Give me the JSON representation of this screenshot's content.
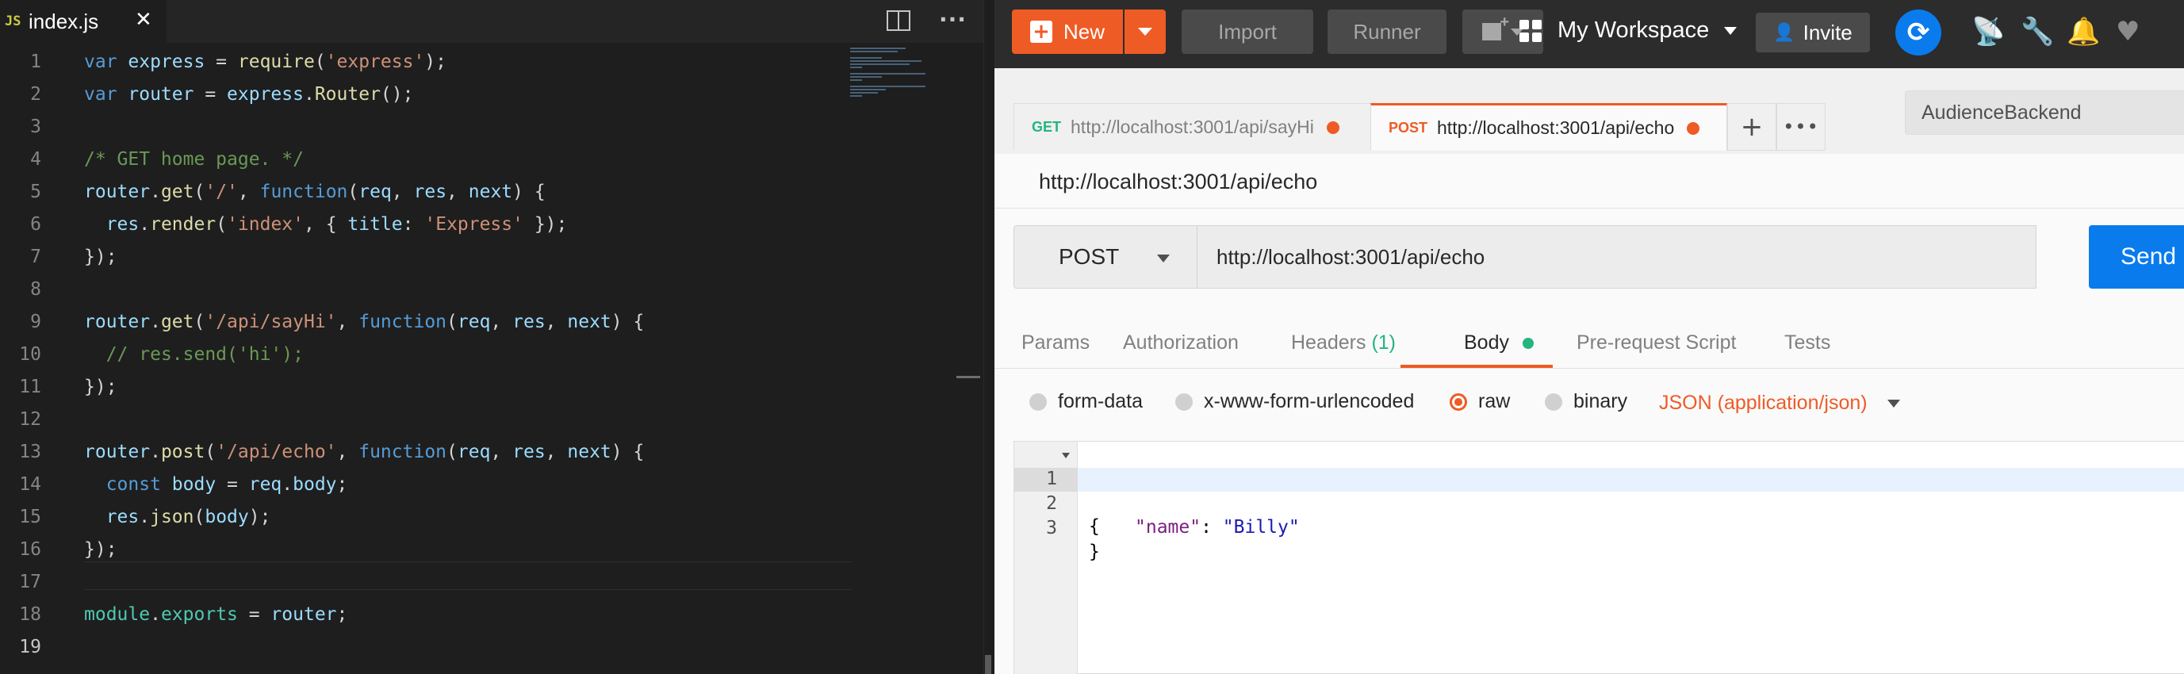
{
  "editor": {
    "tab": {
      "icon": "JS",
      "title": "index.js",
      "close": "✕"
    },
    "code_lines": [
      {
        "n": "1",
        "segments": [
          [
            "kw",
            "var "
          ],
          [
            "var",
            "express"
          ],
          [
            "pl",
            " = "
          ],
          [
            "fn",
            "require"
          ],
          [
            "pl",
            "("
          ],
          [
            "str",
            "'express'"
          ],
          [
            "pl",
            ");"
          ]
        ]
      },
      {
        "n": "2",
        "segments": [
          [
            "kw",
            "var "
          ],
          [
            "var",
            "router"
          ],
          [
            "pl",
            " = "
          ],
          [
            "var",
            "express"
          ],
          [
            "pl",
            "."
          ],
          [
            "fn",
            "Router"
          ],
          [
            "pl",
            "();"
          ]
        ]
      },
      {
        "n": "3",
        "segments": []
      },
      {
        "n": "4",
        "segments": [
          [
            "cm",
            "/* GET home page. */"
          ]
        ]
      },
      {
        "n": "5",
        "segments": [
          [
            "var",
            "router"
          ],
          [
            "pl",
            "."
          ],
          [
            "fn",
            "get"
          ],
          [
            "pl",
            "("
          ],
          [
            "str",
            "'/'"
          ],
          [
            "pl",
            ", "
          ],
          [
            "kw",
            "function"
          ],
          [
            "pl",
            "("
          ],
          [
            "var",
            "req"
          ],
          [
            "pl",
            ", "
          ],
          [
            "var",
            "res"
          ],
          [
            "pl",
            ", "
          ],
          [
            "var",
            "next"
          ],
          [
            "pl",
            ") {"
          ]
        ]
      },
      {
        "n": "6",
        "segments": [
          [
            "pl",
            "  "
          ],
          [
            "var",
            "res"
          ],
          [
            "pl",
            "."
          ],
          [
            "fn",
            "render"
          ],
          [
            "pl",
            "("
          ],
          [
            "str",
            "'index'"
          ],
          [
            "pl",
            ", { "
          ],
          [
            "var",
            "title"
          ],
          [
            "pl",
            ": "
          ],
          [
            "str",
            "'Express'"
          ],
          [
            "pl",
            " });"
          ]
        ]
      },
      {
        "n": "7",
        "segments": [
          [
            "pl",
            "});"
          ]
        ]
      },
      {
        "n": "8",
        "segments": []
      },
      {
        "n": "9",
        "segments": [
          [
            "var",
            "router"
          ],
          [
            "pl",
            "."
          ],
          [
            "fn",
            "get"
          ],
          [
            "pl",
            "("
          ],
          [
            "str",
            "'/api/sayHi'"
          ],
          [
            "pl",
            ", "
          ],
          [
            "kw",
            "function"
          ],
          [
            "pl",
            "("
          ],
          [
            "var",
            "req"
          ],
          [
            "pl",
            ", "
          ],
          [
            "var",
            "res"
          ],
          [
            "pl",
            ", "
          ],
          [
            "var",
            "next"
          ],
          [
            "pl",
            ") {"
          ]
        ]
      },
      {
        "n": "10",
        "segments": [
          [
            "pl",
            "  "
          ],
          [
            "cm",
            "// res.send('hi');"
          ]
        ]
      },
      {
        "n": "11",
        "segments": [
          [
            "pl",
            "});"
          ]
        ]
      },
      {
        "n": "12",
        "segments": []
      },
      {
        "n": "13",
        "segments": [
          [
            "var",
            "router"
          ],
          [
            "pl",
            "."
          ],
          [
            "fn",
            "post"
          ],
          [
            "pl",
            "("
          ],
          [
            "str",
            "'/api/echo'"
          ],
          [
            "pl",
            ", "
          ],
          [
            "kw",
            "function"
          ],
          [
            "pl",
            "("
          ],
          [
            "var",
            "req"
          ],
          [
            "pl",
            ", "
          ],
          [
            "var",
            "res"
          ],
          [
            "pl",
            ", "
          ],
          [
            "var",
            "next"
          ],
          [
            "pl",
            ") {"
          ]
        ]
      },
      {
        "n": "14",
        "segments": [
          [
            "pl",
            "  "
          ],
          [
            "kw",
            "const "
          ],
          [
            "var",
            "body"
          ],
          [
            "pl",
            " = "
          ],
          [
            "var",
            "req"
          ],
          [
            "pl",
            "."
          ],
          [
            "var",
            "body"
          ],
          [
            "pl",
            ";"
          ]
        ]
      },
      {
        "n": "15",
        "segments": [
          [
            "pl",
            "  "
          ],
          [
            "var",
            "res"
          ],
          [
            "pl",
            "."
          ],
          [
            "fn",
            "json"
          ],
          [
            "pl",
            "("
          ],
          [
            "var",
            "body"
          ],
          [
            "pl",
            ");"
          ]
        ]
      },
      {
        "n": "16",
        "segments": [
          [
            "pl",
            "});"
          ]
        ]
      },
      {
        "n": "17",
        "segments": []
      },
      {
        "n": "18",
        "segments": [
          [
            "ty",
            "module"
          ],
          [
            "pl",
            "."
          ],
          [
            "ty",
            "exports"
          ],
          [
            "pl",
            " = "
          ],
          [
            "var",
            "router"
          ],
          [
            "pl",
            ";"
          ]
        ]
      },
      {
        "n": "19",
        "segments": []
      }
    ]
  },
  "postman": {
    "header": {
      "new_label": "New",
      "import_label": "Import",
      "runner_label": "Runner",
      "workspace_label": "My Workspace",
      "invite_label": "Invite"
    },
    "tabs": [
      {
        "method": "GET",
        "method_color": "#26b47f",
        "url": "http://localhost:3001/api/sayHi"
      },
      {
        "method": "POST",
        "method_color": "#ef5b25",
        "url": "http://localhost:3001/api/echo"
      }
    ],
    "environment": "AudienceBackend",
    "request_name": "http://localhost:3001/api/echo",
    "method": "POST",
    "url": "http://localhost:3001/api/echo",
    "send_label": "Send",
    "subtabs": {
      "params": "Params",
      "authorization": "Authorization",
      "headers": "Headers",
      "headers_count": "(1)",
      "body": "Body",
      "prerequest": "Pre-request Script",
      "tests": "Tests"
    },
    "body_modes": {
      "form_data": "form-data",
      "urlencoded": "x-www-form-urlencoded",
      "raw": "raw",
      "binary": "binary",
      "selected": "raw"
    },
    "content_type": "JSON (application/json)",
    "body_lines": [
      {
        "n": "1",
        "text": "{"
      },
      {
        "n": "2",
        "key": "\"name\"",
        "sep": ": ",
        "value": "\"Billy\""
      },
      {
        "n": "3",
        "text": "}"
      }
    ]
  }
}
